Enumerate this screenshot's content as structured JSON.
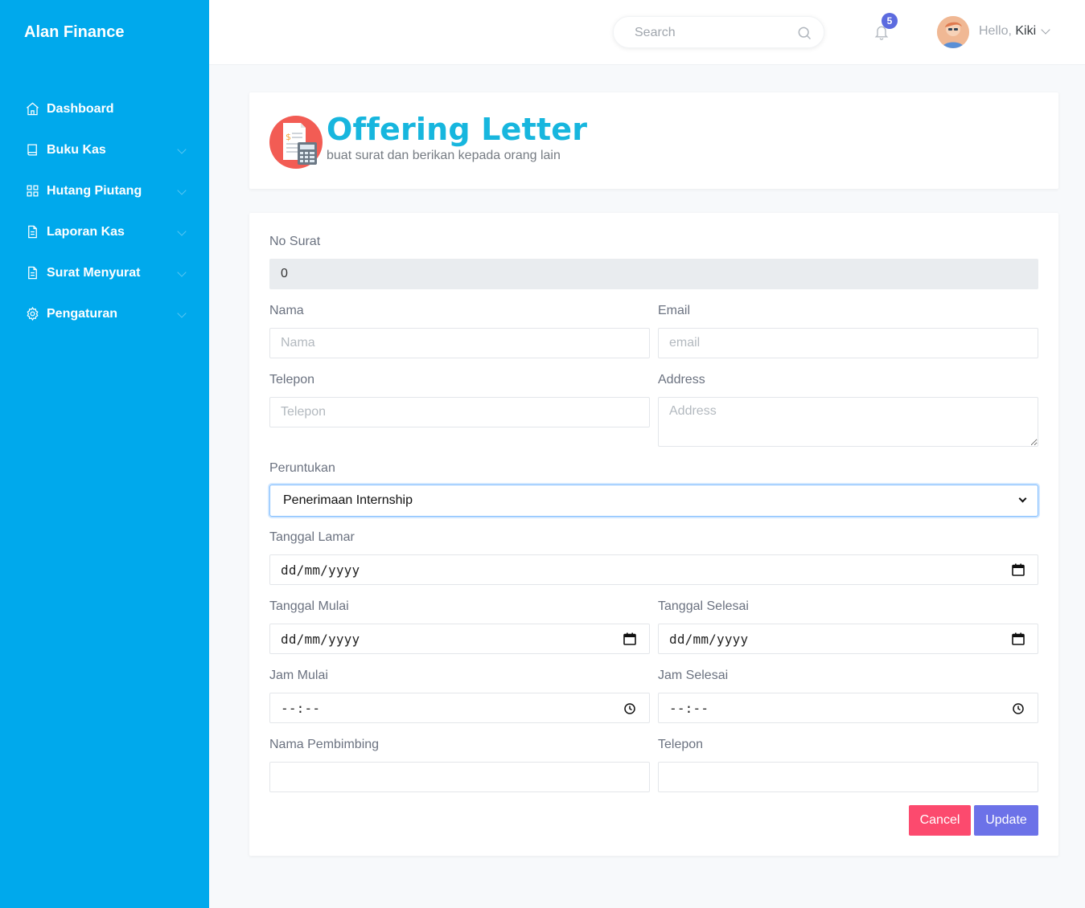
{
  "app": {
    "brand": "Alan Finance"
  },
  "sidebar": {
    "items": [
      {
        "label": "Dashboard",
        "icon": "home-icon",
        "has_submenu": false
      },
      {
        "label": "Buku Kas",
        "icon": "book-icon",
        "has_submenu": true
      },
      {
        "label": "Hutang Piutang",
        "icon": "grid-icon",
        "has_submenu": true
      },
      {
        "label": "Laporan Kas",
        "icon": "file-icon",
        "has_submenu": true
      },
      {
        "label": "Surat Menyurat",
        "icon": "file-icon",
        "has_submenu": true
      },
      {
        "label": "Pengaturan",
        "icon": "gear-icon",
        "has_submenu": true
      }
    ]
  },
  "topbar": {
    "search_placeholder": "Search",
    "notification_count": "5",
    "greeting": "Hello,",
    "username": "Kiki"
  },
  "header": {
    "title": "Offering Letter",
    "subtitle": "buat surat dan berikan kepada orang lain"
  },
  "form": {
    "no_surat_label": "No Surat",
    "no_surat_value": "0",
    "nama_label": "Nama",
    "nama_placeholder": "Nama",
    "email_label": "Email",
    "email_placeholder": "email",
    "telepon_label": "Telepon",
    "telepon_placeholder": "Telepon",
    "address_label": "Address",
    "address_placeholder": "Address",
    "peruntukan_label": "Peruntukan",
    "peruntukan_value": "Penerimaan Internship",
    "tanggal_lamar_label": "Tanggal Lamar",
    "tanggal_lamar_value": "dd/mm/yyyy",
    "tanggal_mulai_label": "Tanggal Mulai",
    "tanggal_mulai_value": "dd/mm/yyyy",
    "tanggal_selesai_label": "Tanggal Selesai",
    "tanggal_selesai_value": "dd/mm/yyyy",
    "jam_mulai_label": "Jam Mulai",
    "jam_mulai_value": "--:--",
    "jam_selesai_label": "Jam Selesai",
    "jam_selesai_value": "--:--",
    "pembimbing_label": "Nama Pembimbing",
    "telepon_pembimbing_label": "Telepon",
    "cancel_label": "Cancel",
    "update_label": "Update"
  },
  "colors": {
    "sidebar": "#00a9ec",
    "title": "#17b6de",
    "cancel": "#fc4a6e",
    "update": "#6c72e8",
    "badge": "#5c6bdf"
  }
}
